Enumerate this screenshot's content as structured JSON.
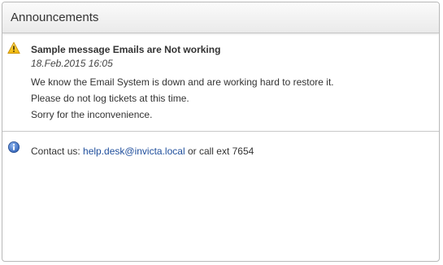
{
  "panel": {
    "title": "Announcements"
  },
  "announcements": [
    {
      "type": "warning",
      "icon": "warning-icon",
      "title": "Sample message Emails are Not working",
      "date": "18.Feb.2015 16:05",
      "lines": [
        "We know the Email System is down and are working hard to restore it.",
        "Please do not log tickets at this time.",
        "Sorry for the inconvenience."
      ]
    }
  ],
  "contact": {
    "icon": "info-icon",
    "prefix": "Contact us: ",
    "email": "help.desk@invicta.local",
    "suffix": " or call ext 7654"
  },
  "colors": {
    "link": "#1f4e9c",
    "warning_fill": "#f5c518",
    "info_fill": "#3a6fc4"
  }
}
